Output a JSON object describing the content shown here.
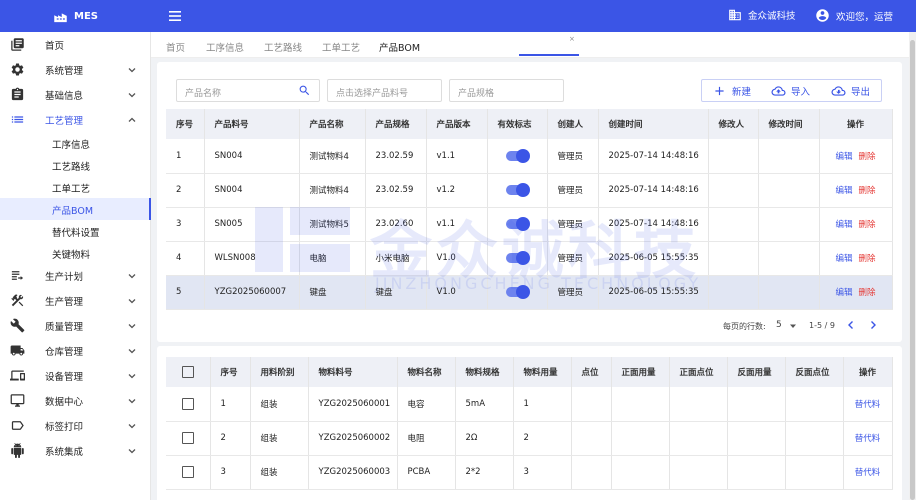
{
  "app": {
    "name": "MES"
  },
  "header": {
    "company": "金众诚科技",
    "greeting": "欢迎您，运营"
  },
  "sidebar": {
    "items": [
      {
        "label": "首页",
        "icon": "home-icon"
      },
      {
        "label": "系统管理",
        "icon": "gear-icon"
      },
      {
        "label": "基础信息",
        "icon": "clipboard-icon"
      },
      {
        "label": "工艺管理",
        "icon": "list-icon",
        "open": true
      },
      {
        "label": "生产计划",
        "icon": "plan-list-icon"
      },
      {
        "label": "生产管理",
        "icon": "tools-icon"
      },
      {
        "label": "质量管理",
        "icon": "wrench-icon"
      },
      {
        "label": "仓库管理",
        "icon": "truck-icon"
      },
      {
        "label": "设备管理",
        "icon": "devices-icon"
      },
      {
        "label": "数据中心",
        "icon": "monitor-icon"
      },
      {
        "label": "标签打印",
        "icon": "label-icon"
      },
      {
        "label": "系统集成",
        "icon": "android-icon"
      }
    ],
    "sub_items": [
      "工序信息",
      "工艺路线",
      "工单工艺",
      "产品BOM",
      "替代料设置",
      "关键物料"
    ]
  },
  "tabs": [
    {
      "label": "首页"
    },
    {
      "label": "工序信息"
    },
    {
      "label": "工艺路线"
    },
    {
      "label": "工单工艺"
    },
    {
      "label": "产品BOM",
      "active": true
    }
  ],
  "tab_close": "×",
  "filters": {
    "product_name_placeholder": "产品名称",
    "product_code_placeholder": "点击选择产品料号",
    "product_spec_placeholder": "产品规格"
  },
  "toolbar": {
    "new_label": "新建",
    "import_label": "导入",
    "export_label": "导出"
  },
  "bom_table": {
    "headers": [
      "序号",
      "产品料号",
      "产品名称",
      "产品规格",
      "产品版本",
      "有效标志",
      "创建人",
      "创建时间",
      "修改人",
      "修改时间",
      "操作"
    ],
    "rows": [
      {
        "no": "1",
        "code": "SN004",
        "name": "测试物料4",
        "spec": "23.02.59",
        "version": "v1.1",
        "valid": true,
        "creator": "管理员",
        "created": "2025-07-14 14:48:16",
        "modifier": "",
        "modified": ""
      },
      {
        "no": "2",
        "code": "SN004",
        "name": "测试物料4",
        "spec": "23.02.59",
        "version": "v1.2",
        "valid": true,
        "creator": "管理员",
        "created": "2025-07-14 14:48:16",
        "modifier": "",
        "modified": ""
      },
      {
        "no": "3",
        "code": "SN005",
        "name": "测试物料5",
        "spec": "23.02.60",
        "version": "v1.1",
        "valid": true,
        "creator": "管理员",
        "created": "2025-07-14 14:48:16",
        "modifier": "",
        "modified": ""
      },
      {
        "no": "4",
        "code": "WLSN008",
        "name": "电脑",
        "spec": "小米电脑",
        "version": "V1.0",
        "valid": true,
        "creator": "管理员",
        "created": "2025-06-05 15:55:35",
        "modifier": "",
        "modified": ""
      },
      {
        "no": "5",
        "code": "YZG2025060007",
        "name": "键盘",
        "spec": "键盘",
        "version": "V1.0",
        "valid": true,
        "creator": "管理员",
        "created": "2025-06-05 15:55:35",
        "modifier": "",
        "modified": "",
        "highlighted": true
      }
    ],
    "edit_label": "编辑",
    "delete_label": "删除"
  },
  "pagination": {
    "rows_per_page_label": "每页的行数:",
    "rows_per_page": "5",
    "range": "1-5 / 9"
  },
  "material_table": {
    "headers": [
      "序号",
      "用料阶别",
      "物料料号",
      "物料名称",
      "物料规格",
      "物料用量",
      "点位",
      "正面用量",
      "正面点位",
      "反面用量",
      "反面点位",
      "操作"
    ],
    "rows": [
      {
        "no": "1",
        "stage": "组装",
        "code": "YZG2025060001",
        "name": "电容",
        "spec": "5mA",
        "qty": "1"
      },
      {
        "no": "2",
        "stage": "组装",
        "code": "YZG2025060002",
        "name": "电阻",
        "spec": "2Ω",
        "qty": "2"
      },
      {
        "no": "3",
        "stage": "组装",
        "code": "YZG2025060003",
        "name": "PCBA",
        "spec": "2*2",
        "qty": "3"
      }
    ],
    "replace_label": "替代料"
  },
  "watermark": {
    "text": "金众诚科技",
    "sub": "JINZHONGCHENG TECHNOLOGY"
  },
  "colors": {
    "primary": "#3b55e6",
    "danger": "#e53935",
    "highlight_row": "#e1e6f3"
  }
}
